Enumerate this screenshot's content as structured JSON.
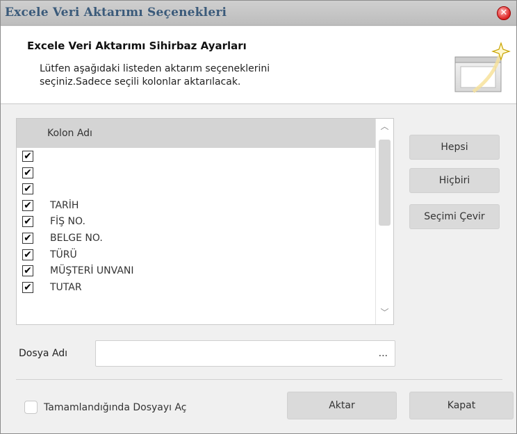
{
  "window": {
    "title": "Excele Veri Aktarımı Seçenekleri"
  },
  "header": {
    "title": "Excele Veri Aktarımı Sihirbaz Ayarları",
    "description": "Lütfen aşağıdaki listeden aktarım seçeneklerini\nseçiniz.Sadece seçili kolonlar aktarılacak."
  },
  "column_list": {
    "header": "Kolon Adı",
    "rows": [
      {
        "label": "",
        "checked": true
      },
      {
        "label": "",
        "checked": true
      },
      {
        "label": "",
        "checked": true
      },
      {
        "label": "TARİH",
        "checked": true
      },
      {
        "label": "FİŞ NO.",
        "checked": true
      },
      {
        "label": "BELGE NO.",
        "checked": true
      },
      {
        "label": "TÜRÜ",
        "checked": true
      },
      {
        "label": "MÜŞTERİ UNVANI",
        "checked": true
      },
      {
        "label": "TUTAR",
        "checked": true
      }
    ],
    "check_mark": "✔"
  },
  "side_buttons": {
    "all": "Hepsi",
    "none": "Hiçbiri",
    "invert": "Seçimi Çevir"
  },
  "file": {
    "label": "Dosya Adı",
    "value": "",
    "browse": "..."
  },
  "footer": {
    "open_when_done_label": "Tamamlandığında Dosyayı Aç",
    "open_when_done_checked": false,
    "export_label": "Aktar",
    "close_label": "Kapat"
  },
  "icons": {
    "close": "close-icon",
    "wizard": "wizard-window-icon",
    "scroll_up": "chevron-up-icon",
    "scroll_down": "chevron-down-icon"
  }
}
